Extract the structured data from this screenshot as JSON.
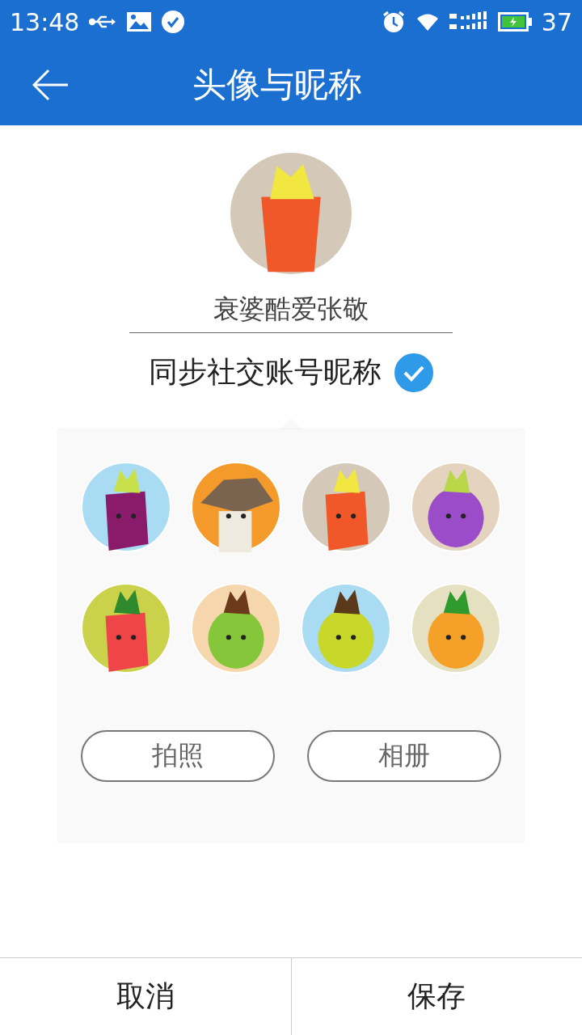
{
  "status_bar": {
    "time": "13:48",
    "battery_percent": "37"
  },
  "header": {
    "title": "头像与昵称"
  },
  "profile": {
    "avatar": {
      "kind": "carrot",
      "color": "#d4c9b8"
    },
    "nickname": "衰婆酷爱张敬"
  },
  "sync": {
    "label": "同步社交账号昵称",
    "checked": true
  },
  "avatars": [
    {
      "kind": "eggplant",
      "color": "#a9dcf2"
    },
    {
      "kind": "mushroom",
      "color": "#f39a2a"
    },
    {
      "kind": "carrot",
      "color": "#d4c9b8"
    },
    {
      "kind": "grape",
      "color": "#e3d3bf"
    },
    {
      "kind": "pepper",
      "color": "#c9d24a"
    },
    {
      "kind": "apple",
      "color": "#f6d7ad"
    },
    {
      "kind": "pear",
      "color": "#a9dcf2"
    },
    {
      "kind": "pineapple",
      "color": "#e5e0bf"
    }
  ],
  "panel_buttons": [
    "拍照",
    "相册"
  ],
  "footer_buttons": [
    "取消",
    "保存"
  ]
}
